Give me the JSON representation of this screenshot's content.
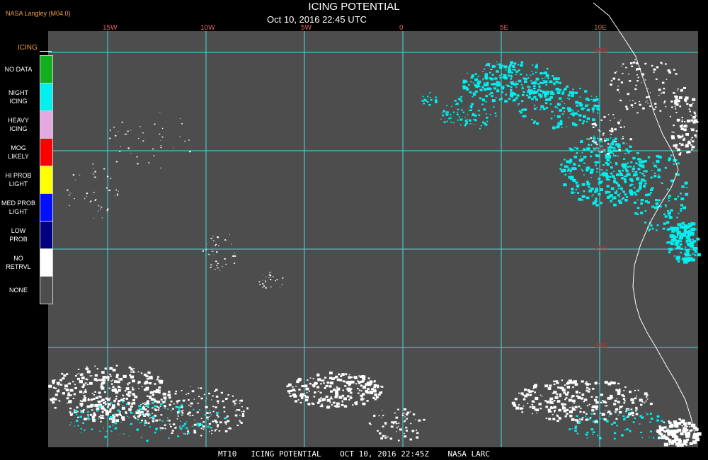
{
  "header": {
    "title": "ICING POTENTIAL",
    "subtitle": "Oct 10, 2016 22:45 UTC",
    "producer": "NASA Langley (M04.0)"
  },
  "map": {
    "background_color": "#4d4d4d",
    "grid_color": "#3fe0e0",
    "coast_color": "#ffffff",
    "longitude_labels": [
      "15W",
      "10W",
      "5W",
      "0",
      "5E",
      "10E"
    ],
    "latitude_labels": [
      "15S",
      "20S",
      "25S",
      "30S"
    ]
  },
  "legend": {
    "title": "ICING",
    "entries": [
      {
        "label": "NO DATA",
        "color": "#12b01e"
      },
      {
        "label": "NIGHT\nICING",
        "color": "#00f0f0"
      },
      {
        "label": "HEAVY\nICING",
        "color": "#e6a8e0"
      },
      {
        "label": "MOG\nLIKELY",
        "color": "#ff0000"
      },
      {
        "label": "HI PROB\nLIGHT",
        "color": "#ffff00"
      },
      {
        "label": "MED PROB\nLIGHT",
        "color": "#0010ff"
      },
      {
        "label": "LOW\nPROB",
        "color": "#000080"
      },
      {
        "label": "NO\nRETRVL",
        "color": "#ffffff"
      },
      {
        "label": "NONE",
        "color": "#4d4d4d"
      }
    ]
  },
  "footer": "MT10   ICING POTENTIAL    OCT 10, 2016 22:45Z    NASA LARC"
}
